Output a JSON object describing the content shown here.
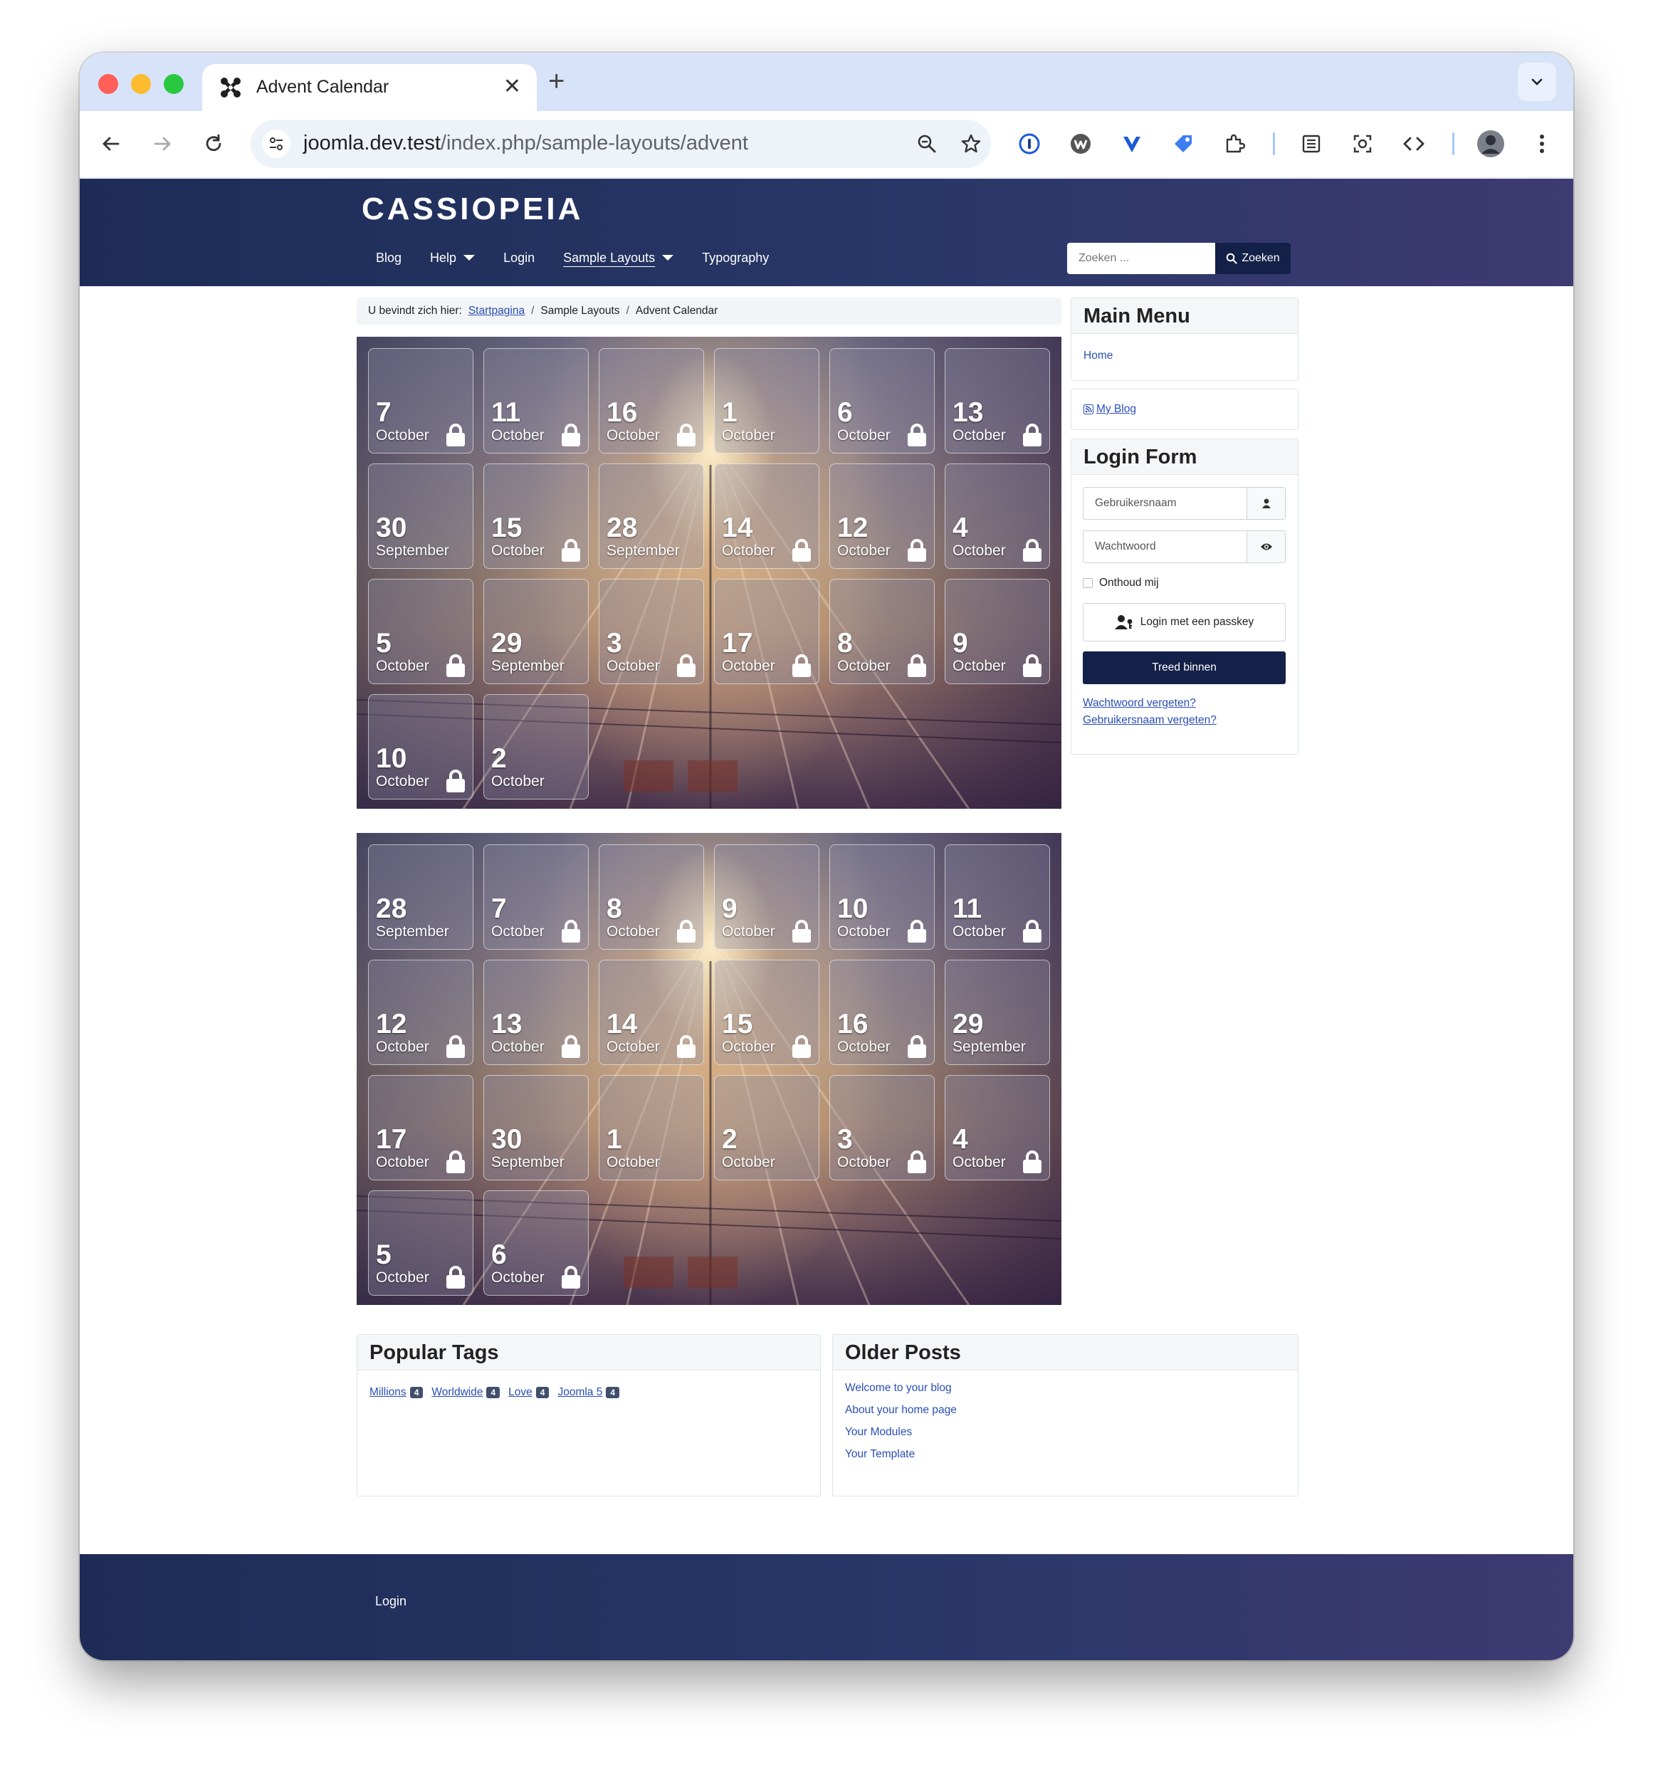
{
  "browser": {
    "tab_title": "Advent Calendar",
    "tab_close": "✕",
    "new_tab": "+",
    "url_host": "joomla.dev.test",
    "url_path": "/index.php/sample-layouts/advent"
  },
  "site": {
    "brand": "CASSIOPEIA",
    "menu": [
      {
        "label": "Blog"
      },
      {
        "label": "Help",
        "dropdown": true
      },
      {
        "label": "Login"
      },
      {
        "label": "Sample Layouts",
        "dropdown": true,
        "active": true
      },
      {
        "label": "Typography"
      }
    ],
    "search_placeholder": "Zoeken ...",
    "search_button": "Zoeken"
  },
  "breadcrumb": {
    "prefix": "U bevindt zich hier:",
    "items": [
      "Startpagina",
      "Sample Layouts",
      "Advent Calendar"
    ],
    "separator": "/"
  },
  "calendars": [
    {
      "doors": [
        {
          "day": "7",
          "month": "October",
          "locked": true
        },
        {
          "day": "11",
          "month": "October",
          "locked": true
        },
        {
          "day": "16",
          "month": "October",
          "locked": true
        },
        {
          "day": "1",
          "month": "October",
          "locked": false
        },
        {
          "day": "6",
          "month": "October",
          "locked": true
        },
        {
          "day": "13",
          "month": "October",
          "locked": true
        },
        {
          "day": "30",
          "month": "September",
          "locked": false
        },
        {
          "day": "15",
          "month": "October",
          "locked": true
        },
        {
          "day": "28",
          "month": "September",
          "locked": false
        },
        {
          "day": "14",
          "month": "October",
          "locked": true
        },
        {
          "day": "12",
          "month": "October",
          "locked": true
        },
        {
          "day": "4",
          "month": "October",
          "locked": true
        },
        {
          "day": "5",
          "month": "October",
          "locked": true
        },
        {
          "day": "29",
          "month": "September",
          "locked": false
        },
        {
          "day": "3",
          "month": "October",
          "locked": true
        },
        {
          "day": "17",
          "month": "October",
          "locked": true
        },
        {
          "day": "8",
          "month": "October",
          "locked": true
        },
        {
          "day": "9",
          "month": "October",
          "locked": true
        },
        {
          "day": "10",
          "month": "October",
          "locked": true
        },
        {
          "day": "2",
          "month": "October",
          "locked": false
        }
      ]
    },
    {
      "doors": [
        {
          "day": "28",
          "month": "September",
          "locked": false
        },
        {
          "day": "7",
          "month": "October",
          "locked": true
        },
        {
          "day": "8",
          "month": "October",
          "locked": true
        },
        {
          "day": "9",
          "month": "October",
          "locked": true
        },
        {
          "day": "10",
          "month": "October",
          "locked": true
        },
        {
          "day": "11",
          "month": "October",
          "locked": true
        },
        {
          "day": "12",
          "month": "October",
          "locked": true
        },
        {
          "day": "13",
          "month": "October",
          "locked": true
        },
        {
          "day": "14",
          "month": "October",
          "locked": true
        },
        {
          "day": "15",
          "month": "October",
          "locked": true
        },
        {
          "day": "16",
          "month": "October",
          "locked": true
        },
        {
          "day": "29",
          "month": "September",
          "locked": false
        },
        {
          "day": "17",
          "month": "October",
          "locked": true
        },
        {
          "day": "30",
          "month": "September",
          "locked": false
        },
        {
          "day": "1",
          "month": "October",
          "locked": false
        },
        {
          "day": "2",
          "month": "October",
          "locked": false
        },
        {
          "day": "3",
          "month": "October",
          "locked": true
        },
        {
          "day": "4",
          "month": "October",
          "locked": true
        },
        {
          "day": "5",
          "month": "October",
          "locked": true
        },
        {
          "day": "6",
          "month": "October",
          "locked": true
        }
      ]
    }
  ],
  "sidebar": {
    "main_menu": {
      "title": "Main Menu",
      "home": "Home"
    },
    "blog_link": "My Blog",
    "login_form": {
      "title": "Login Form",
      "username_placeholder": "Gebruikersnaam",
      "password_placeholder": "Wachtwoord",
      "remember": "Onthoud mij",
      "passkey_button": "Login met een passkey",
      "submit_button": "Treed binnen",
      "forgot_password": "Wachtwoord vergeten?",
      "forgot_username": "Gebruikersnaam vergeten?"
    }
  },
  "popular_tags": {
    "title": "Popular Tags",
    "tags": [
      {
        "label": "Millions",
        "count": "4"
      },
      {
        "label": "Worldwide",
        "count": "4"
      },
      {
        "label": "Love",
        "count": "4"
      },
      {
        "label": "Joomla 5",
        "count": "4"
      }
    ]
  },
  "older_posts": {
    "title": "Older Posts",
    "items": [
      "Welcome to your blog",
      "About your home page",
      "Your Modules",
      "Your Template"
    ]
  },
  "footer": {
    "login": "Login"
  },
  "colors": {
    "header": "#1d2b56",
    "accent": "#132047",
    "link": "#2a4fb4"
  }
}
